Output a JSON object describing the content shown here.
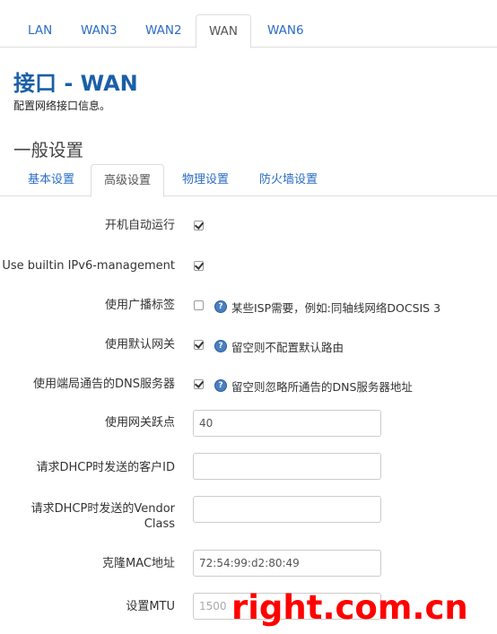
{
  "top_tabs": [
    "LAN",
    "WAN3",
    "WAN2",
    "WAN",
    "WAN6"
  ],
  "page": {
    "title": "接口 - WAN",
    "description": "配置网络接口信息。"
  },
  "section": {
    "title": "一般设置",
    "tabs": [
      "基本设置",
      "高级设置",
      "物理设置",
      "防火墙设置"
    ]
  },
  "fields": {
    "autostart": {
      "label": "开机自动运行",
      "checked": true
    },
    "ipv6": {
      "label": "Use builtin IPv6-management",
      "checked": true
    },
    "broadcast": {
      "label": "使用广播标签",
      "checked": false,
      "hint": "某些ISP需要，例如:同轴线网络DOCSIS 3"
    },
    "default_gw": {
      "label": "使用默认网关",
      "checked": true,
      "hint": "留空则不配置默认路由"
    },
    "peer_dns": {
      "label": "使用端局通告的DNS服务器",
      "checked": true,
      "hint": "留空则忽略所通告的DNS服务器地址"
    },
    "metric": {
      "label": "使用网关跃点",
      "value": "40"
    },
    "client_id": {
      "label": "请求DHCP时发送的客户ID",
      "value": ""
    },
    "vendor_class": {
      "label": "请求DHCP时发送的Vendor Class",
      "value": ""
    },
    "mac": {
      "label": "克隆MAC地址",
      "value": "72:54:99:d2:80:49"
    },
    "mtu": {
      "label": "设置MTU",
      "placeholder": "1500"
    }
  },
  "watermark": "right.com.cn",
  "colors": {
    "link": "#2a6cc4",
    "title": "#1a5fa8",
    "watermark": "#ff0000",
    "help_icon": "#4a7fc1"
  }
}
